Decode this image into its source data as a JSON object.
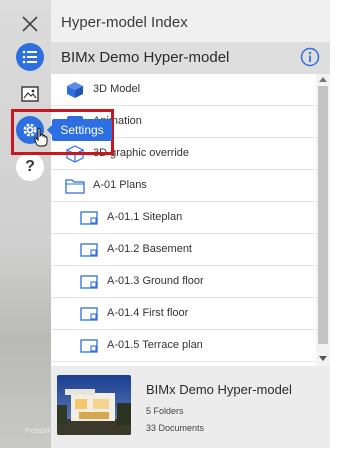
{
  "colors": {
    "accent": "#2d6fe0",
    "highlight_border": "#c8171e",
    "panel_bg": "#f0f0f0",
    "header_bar_bg": "#dedede"
  },
  "rail": {
    "close_icon": "close-icon",
    "list_icon": "list-icon",
    "image_icon": "image-icon",
    "settings_icon": "gear-icon",
    "help_label": "?",
    "settings_tooltip": "Settings",
    "bottom_tag": "Picasolli"
  },
  "panel": {
    "title": "Hyper-model Index",
    "model_title": "BIMx Demo Hyper-model",
    "info_icon": "info-icon"
  },
  "list": {
    "items": [
      {
        "label": "3D Model",
        "icon": "cube-solid-icon",
        "indent": 0
      },
      {
        "label": "Animation",
        "icon": "animation-icon",
        "indent": 0
      },
      {
        "label": "3D graphic override",
        "icon": "cube-outline-icon",
        "indent": 0
      },
      {
        "label": "A-01 Plans",
        "icon": "folder-icon",
        "indent": 0
      },
      {
        "label": "A-01.1 Siteplan",
        "icon": "plan-icon",
        "indent": 1
      },
      {
        "label": "A-01.2 Basement",
        "icon": "plan-icon",
        "indent": 1
      },
      {
        "label": "A-01.3 Ground floor",
        "icon": "plan-icon",
        "indent": 1
      },
      {
        "label": "A-01.4 First floor",
        "icon": "plan-icon",
        "indent": 1
      },
      {
        "label": "A-01.5 Terrace plan",
        "icon": "plan-icon",
        "indent": 1
      },
      {
        "label": "",
        "icon": "plan-icon",
        "indent": 1
      }
    ]
  },
  "card": {
    "title": "BIMx Demo Hyper-model",
    "folders": "5 Folders",
    "documents": "33 Documents"
  }
}
